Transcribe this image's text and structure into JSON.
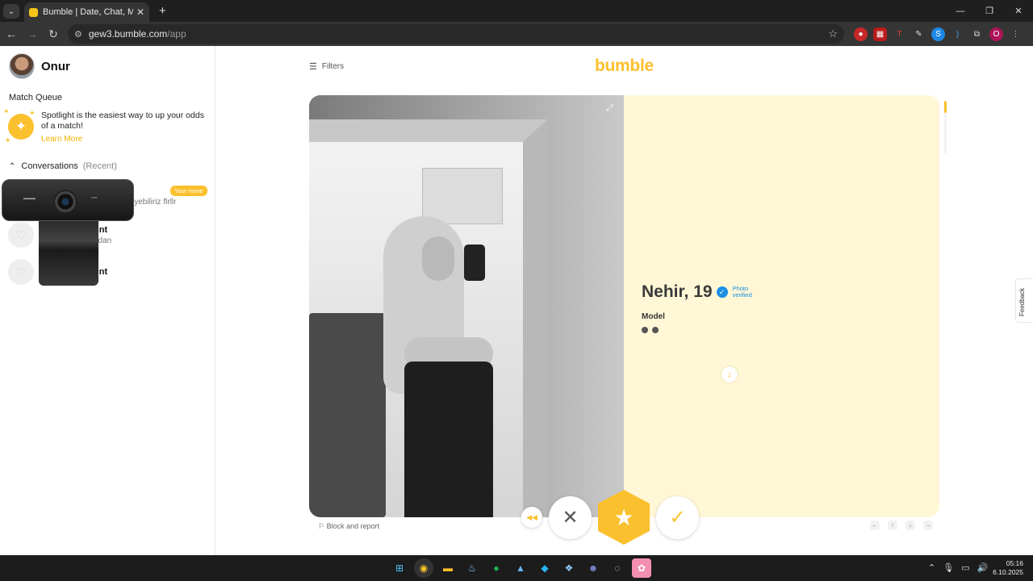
{
  "browser": {
    "tab_title": "Bumble | Date, Chat, Meet New",
    "url_host": "gew3.bumble.com",
    "url_path": "/app"
  },
  "sidebar": {
    "user_name": "Onur",
    "match_queue_label": "Match Queue",
    "spotlight_text": "Spotlight is the easiest way to up your odds of a match!",
    "learn_more": "Learn More",
    "conversations_label": "Conversations",
    "recent_label": "(Recent)",
    "conversations": [
      {
        "name": "",
        "message": "iyebiliriz flrllr",
        "badge": "Your move"
      },
      {
        "name": "unt",
        "message": "adan"
      },
      {
        "name": "unt",
        "message": ""
      }
    ]
  },
  "main": {
    "filters_label": "Filters",
    "logo": "bumble",
    "profile": {
      "name_age": "Nehir, 19",
      "verified_label_1": "Photo",
      "verified_label_2": "verified",
      "occupation": "Model"
    },
    "block_report": "Block and report",
    "feedback": "Feedback"
  },
  "taskbar": {
    "time": "05:16",
    "date": "6.10.2025"
  },
  "colors": {
    "accent": "#fbc02d",
    "verified_blue": "#1a8fe3",
    "card_bg": "#fff7d6"
  }
}
